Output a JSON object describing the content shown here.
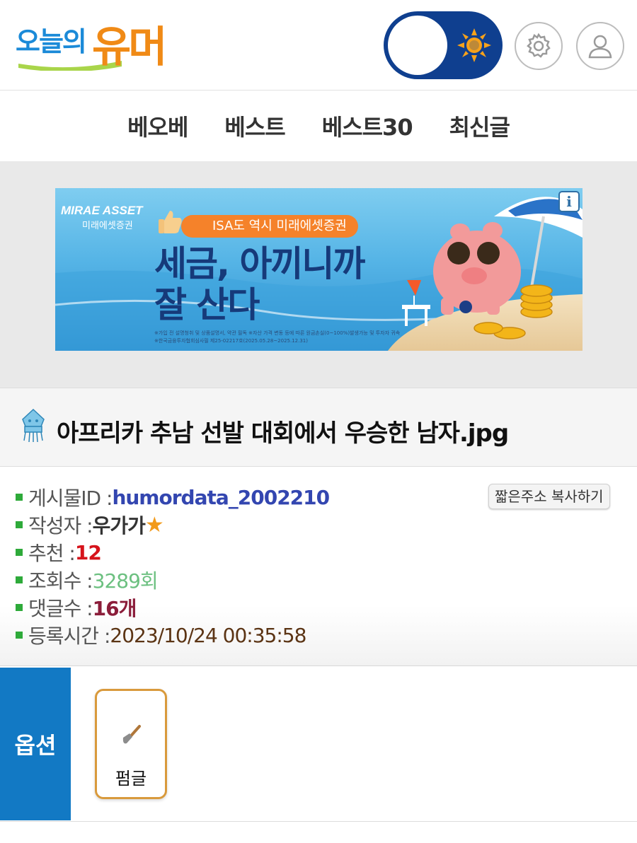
{
  "header": {
    "logo_small": "오늘의",
    "logo_big": "유머",
    "theme_toggle_state": "light",
    "icons": [
      "sun-icon",
      "gear-icon",
      "user-icon"
    ]
  },
  "nav": {
    "items": [
      {
        "label": "베오베"
      },
      {
        "label": "베스트"
      },
      {
        "label": "베스트30"
      },
      {
        "label": "최신글"
      }
    ]
  },
  "ad": {
    "brand": "MIRAE ASSET",
    "brand_sub": "미래에셋증권",
    "pill": "ISA도 역시 미래에셋증권",
    "headline_1": "세금, 아끼니까",
    "headline_2": "잘 산다",
    "fine_1": "※가입 전 설명청취 및 상품설명서, 약관 필독 ※자산 가격 변동 등에 따른 원금손실(0~100%)발생가능 및 투자자 귀속",
    "fine_2": "※한국금융투자협회심사필 제25-02217호(2025.05.28~2025.12.31)",
    "info": "i"
  },
  "post": {
    "title": "아프리카 추남 선발 대회에서 우승한 남자.jpg",
    "meta": {
      "id_label": "게시물ID : ",
      "id_value": "humordata_2002210",
      "author_label": "작성자 : ",
      "author_value": "우가가",
      "author_star": "★",
      "rec_label": "추천 : ",
      "rec_value": "12",
      "views_label": "조회수 : ",
      "views_value": "3289회",
      "comments_label": "댓글수 : ",
      "comments_value": "16개",
      "date_label": "등록시간 : ",
      "date_value": "2023/10/24 00:35:58"
    },
    "copy_short_url": "짧은주소 복사하기"
  },
  "options": {
    "label": "옵션",
    "items": [
      {
        "label": "펌글",
        "icon": "shovel-icon"
      }
    ]
  },
  "colors": {
    "logo_blue": "#1b8ad8",
    "logo_orange": "#f08a16",
    "toggle_bg": "#0f3f8f",
    "options_blue": "#1279c4",
    "id_blue": "#3346b0",
    "rec_red": "#d6131b",
    "views_green": "#6cc080",
    "comments_maroon": "#8b1d3a",
    "date_brown": "#5b3414"
  }
}
